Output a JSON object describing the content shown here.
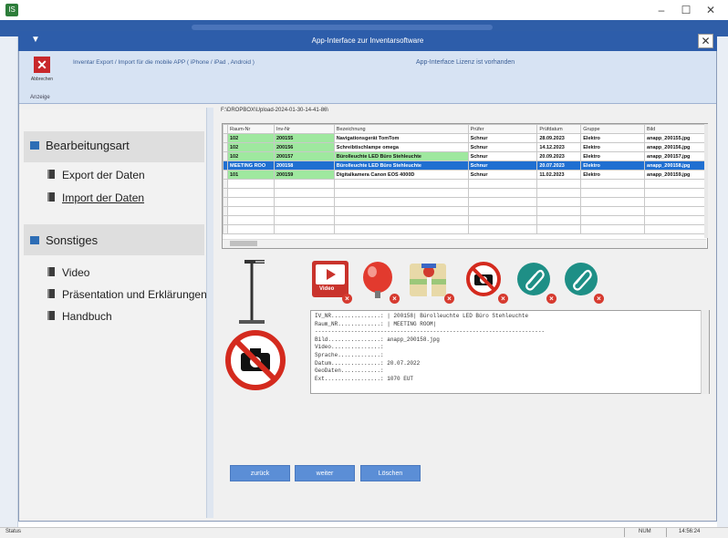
{
  "window": {
    "app_icon": "app-icon",
    "minimize": "–",
    "maximize": "☐",
    "close": "✕"
  },
  "dialog": {
    "title": "App-Interface zur Inventarsoftware",
    "close": "✕",
    "menu_icon": "▼"
  },
  "ribbon": {
    "cancel_label": "Abbrechen",
    "group_label": "Anzeige",
    "title": "Inventar Export / Import für die mobile APP ( iPhone / iPad , Android )",
    "license": "App-Interface Lizenz ist vorhanden"
  },
  "nav": {
    "section1": {
      "label": "Bearbeitungsart",
      "items": [
        "Export der Daten",
        "Import der Daten"
      ]
    },
    "section2": {
      "label": "Sonstiges",
      "items": [
        "Video",
        "Präsentation und Erklärungen",
        "Handbuch"
      ]
    }
  },
  "path": "F:\\DROPBOX\\Upload-2024-01-30-14-41-86\\",
  "table": {
    "columns": [
      "Raum-Nr",
      "Inv-Nr",
      "Bezeichnung",
      "Prüfer",
      "Prüfdatum",
      "Gruppe",
      "Bild"
    ],
    "rows": [
      [
        "102",
        "200155",
        "Navigationsgerät TomTom",
        "Schnur",
        "28.09.2023",
        "Elektro",
        "anapp_200155.jpg"
      ],
      [
        "102",
        "200156",
        "Schreibtischlampe omega",
        "Schnur",
        "14.12.2023",
        "Elektro",
        "anapp_200156.jpg"
      ],
      [
        "102",
        "200157",
        "Bürolleuchte LED Büro Stehleuchte",
        "Schnur",
        "20.09.2023",
        "Elektro",
        "anapp_200157.jpg"
      ],
      [
        "MEETING ROO",
        "200158",
        "Bürolleuchte LED Büro Stehleuchte",
        "Schnur",
        "20.07.2023",
        "Elektro",
        "anapp_200158.jpg"
      ],
      [
        "101",
        "200159",
        "Digitalkamera Canon EOS 4000D",
        "Schnur",
        "11.02.2023",
        "Elektro",
        "anapp_200159.jpg"
      ]
    ],
    "selected_row": 3
  },
  "media": {
    "video_label": "Video"
  },
  "info_lines": [
    "IV_NR...............: | 200158| Bürolleuchte LED Büro Stehleuchte",
    "Raum_NR.............: | MEETING ROOM|",
    "----------------------------------------------------------------------",
    "Bild................: anapp_200158.jpg",
    "Video...............: ",
    "Sprache.............: ",
    "Datum...............: 20.07.2022",
    "GeoDaten............: ",
    "Ext.................: 1070 EUT"
  ],
  "buttons": {
    "back": "zurück",
    "next": "weiter",
    "delete": "Löschen"
  },
  "statusbar": {
    "left": "Status",
    "mode": "NUM",
    "time": "14:56:24"
  },
  "colors": {
    "titlebar": "#2d5daa",
    "ribbon": "#d7e3f3",
    "selection": "#1f6fd1",
    "row_green": "#9fe89f",
    "button": "#5b8ed6",
    "cancel_red": "#c8282b"
  }
}
